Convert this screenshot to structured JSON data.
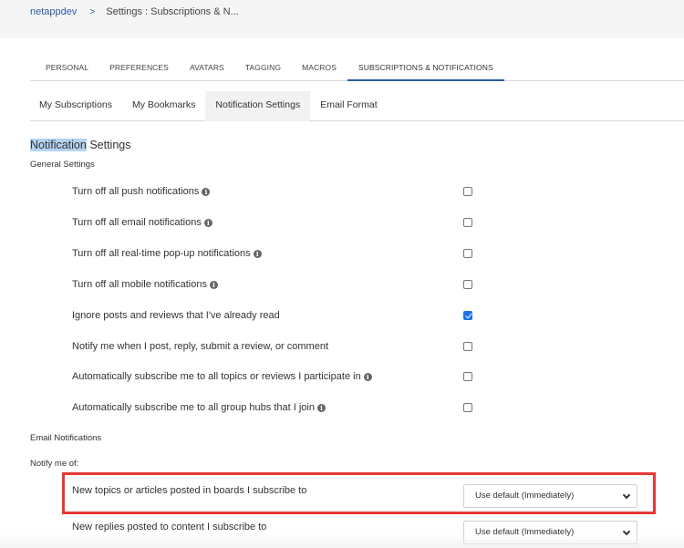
{
  "breadcrumb": {
    "root": "netappdev",
    "separator": ">",
    "current": "Settings : Subscriptions & N..."
  },
  "main_tabs": [
    {
      "label": "PERSONAL",
      "active": false
    },
    {
      "label": "PREFERENCES",
      "active": false
    },
    {
      "label": "AVATARS",
      "active": false
    },
    {
      "label": "TAGGING",
      "active": false
    },
    {
      "label": "MACROS",
      "active": false
    },
    {
      "label": "SUBSCRIPTIONS & NOTIFICATIONS",
      "active": true
    }
  ],
  "sub_tabs": [
    {
      "label": "My Subscriptions",
      "active": false
    },
    {
      "label": "My Bookmarks",
      "active": false
    },
    {
      "label": "Notification Settings",
      "active": true
    },
    {
      "label": "Email Format",
      "active": false
    }
  ],
  "section": {
    "title_highlighted": "Notification",
    "title_rest": " Settings",
    "general_label": "General Settings",
    "email_label": "Email Notifications",
    "notify_label": "Notify me of:"
  },
  "general_settings": [
    {
      "label": "Turn off all push notifications",
      "info": true,
      "checked": false
    },
    {
      "label": "Turn off all email notifications",
      "info": true,
      "checked": false
    },
    {
      "label": "Turn off all real-time pop-up notifications",
      "info": true,
      "checked": false
    },
    {
      "label": "Turn off all mobile notifications",
      "info": true,
      "checked": false
    },
    {
      "label": "Ignore posts and reviews that I've already read",
      "info": false,
      "checked": true
    },
    {
      "label": "Notify me when I post, reply, submit a review, or comment",
      "info": false,
      "checked": false
    },
    {
      "label": "Automatically subscribe me to all topics or reviews I participate in",
      "info": true,
      "checked": false
    },
    {
      "label": "Automatically subscribe me to all group hubs that I join",
      "info": true,
      "checked": false
    }
  ],
  "email_settings": [
    {
      "label": "New topics or articles posted in boards I subscribe to",
      "value": "Use default (Immediately)",
      "highlighted": true
    },
    {
      "label": "New replies posted to content I subscribe to",
      "value": "Use default (Immediately)",
      "highlighted": false
    }
  ],
  "icons": {
    "info": "i"
  },
  "colors": {
    "accent": "#2d5aa0",
    "checkbox_checked": "#1a73e8",
    "annotation_red": "#e53935",
    "header_bg": "#f5f5f5"
  }
}
